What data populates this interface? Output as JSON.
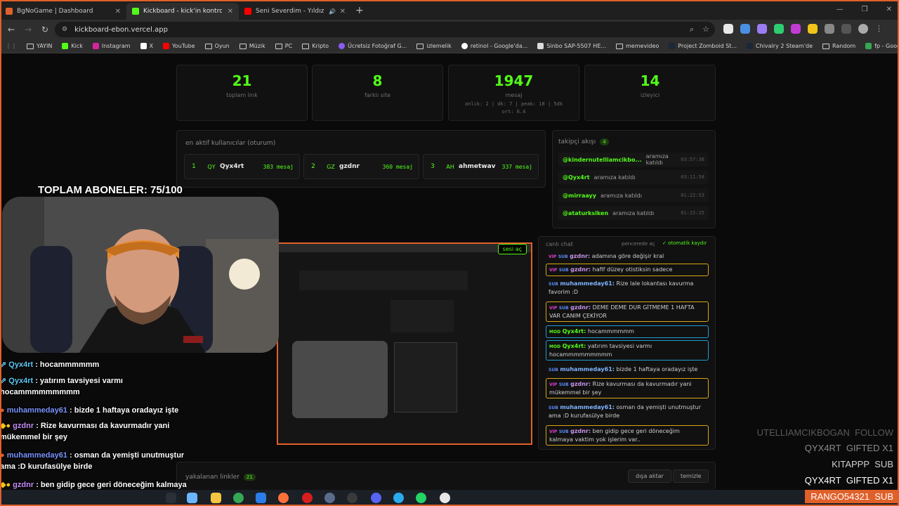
{
  "browser": {
    "tabs": [
      {
        "label": "BgNoGame | Dashboard",
        "active": false
      },
      {
        "label": "Kickboard - kick'in kontrol paneli",
        "active": true
      },
      {
        "label": "Seni Severdim - Yıldız Usmonov",
        "active": false
      }
    ],
    "url": "kickboard-ebon.vercel.app",
    "bookmarks": [
      "YAYIN",
      "Kick",
      "Instagram",
      "X",
      "YouTube",
      "Oyun",
      "Müzik",
      "PC",
      "Kripto",
      "Ücretsiz Fotoğraf G...",
      "izlemelik",
      "retinol - Google'da...",
      "Sinbo SAP-5507 HE...",
      "memevideo",
      "Project Zomboid St...",
      "Chivalry 2 Steam'de",
      "Random",
      "fp - Google Drive"
    ]
  },
  "stats": [
    {
      "value": "21",
      "label": "toplam link"
    },
    {
      "value": "8",
      "label": "farklı site"
    },
    {
      "value": "1947",
      "label": "mesaj",
      "sub1": "anlık: 2 | dk: 7 | peak: 18 | 5dk",
      "sub2": "ort: 6.4"
    },
    {
      "value": "14",
      "label": "izleyici"
    }
  ],
  "active_users": {
    "title": "en aktif kullanıcılar (oturum)",
    "users": [
      {
        "rank": "1",
        "initials": "QY",
        "name": "Qyx4rt",
        "count": "383 mesaj"
      },
      {
        "rank": "2",
        "initials": "GZ",
        "name": "gzdnr",
        "count": "360 mesaj"
      },
      {
        "rank": "3",
        "initials": "AH",
        "name": "ahmetwav",
        "count": "337 mesaj"
      }
    ]
  },
  "followers": {
    "title": "takipçi akışı",
    "count": "4",
    "rows": [
      {
        "user": "@kindernutelliamcikbo...",
        "action": "aramıza katıldı",
        "time": "03:57:38"
      },
      {
        "user": "@Qyx4rt",
        "action": "aramıza katıldı",
        "time": "03:11:58"
      },
      {
        "user": "@mirraayy",
        "action": "aramıza katıldı",
        "time": "01:22:53"
      },
      {
        "user": "@ataturksiken",
        "action": "aramıza katıldı",
        "time": "01:15:25"
      }
    ]
  },
  "live_chat": {
    "title": "canlı chat",
    "open_window": "pencerede aç",
    "autoscroll": "otomatik kaydır",
    "messages": [
      {
        "badges": "VIP SUB",
        "user": "gzdnr:",
        "text": "adamına göre değişir kral"
      },
      {
        "badges": "VIP SUB",
        "user": "gzdnr:",
        "text": "hafif düzey otistiksin sadece"
      },
      {
        "badges": "SUB",
        "user": "muhammeday61:",
        "text": "Rize lale lokantası kavurma favorim :D"
      },
      {
        "badges": "VIP SUB",
        "user": "gzdnr:",
        "text": "DEME DEME DUR GİTMEME 1 HAFTA VAR CANIM ÇEKİYOR"
      },
      {
        "badges": "MOD",
        "user": "Qyx4rt:",
        "text": "hocammmmmm"
      },
      {
        "badges": "MOD",
        "user": "Qyx4rt:",
        "text": "yatırım tavsiyesi varmı hocammmmmmmmm"
      },
      {
        "badges": "SUB",
        "user": "muhammeday61:",
        "text": "bizde 1 haftaya oradayız işte"
      },
      {
        "badges": "VIP SUB",
        "user": "gzdnr:",
        "text": "Rize kavurması da kavurmadır yani mükemmel bir şey"
      },
      {
        "badges": "SUB",
        "user": "muhammeday61:",
        "text": "osman da yemişti unutmuştur ama :D kurufasülye birde"
      },
      {
        "badges": "VIP SUB",
        "user": "gzdnr:",
        "text": "ben gidip gece geri döneceğim kalmaya vaktim yok işlerim var.."
      }
    ]
  },
  "captured_links": {
    "title": "yakalanan linkler",
    "count": "21",
    "export": "dışa aktar",
    "clear": "temizle"
  },
  "preview_badge": "sesi aç",
  "overlay": {
    "subs_goal": "TOPLAM ABONELER: 75/100",
    "chat": [
      {
        "user": "Qyx4rt",
        "text": ": hocammmmmm"
      },
      {
        "user": "Qyx4rt",
        "text": ": yatırım tavsiyesi varmı hocammmmmmmmm"
      },
      {
        "user": "muhammeday61",
        "text": ": bizde 1 haftaya oradayız işte"
      },
      {
        "user": "gzdnr",
        "text": ": Rize kavurması da kavurmadır yani mükemmel bir şey"
      },
      {
        "user": "muhammeday61",
        "text": ": osman da yemişti unutmuştur ama :D kurufasülye birde"
      },
      {
        "user": "gzdnr",
        "text": ": ben gidip gece geri döneceğim kalmaya vaktim yok işlerim var.."
      }
    ],
    "alerts": [
      {
        "name": "UTELLIAMCIKBOGAN",
        "type": "FOLLOW"
      },
      {
        "name": "QYX4RT",
        "type": "GIFTED X1"
      },
      {
        "name": "KITAPPP",
        "type": "SUB"
      },
      {
        "name": "QYX4RT",
        "type": "GIFTED X1"
      },
      {
        "name": "RANGO54321",
        "type": "SUB"
      }
    ]
  },
  "colors": {
    "accent": "#53fc18",
    "vip": "#e23fd1",
    "sub": "#5b8cff",
    "highlight_border": "#d9a514",
    "mod_border": "#1f9bd1"
  }
}
